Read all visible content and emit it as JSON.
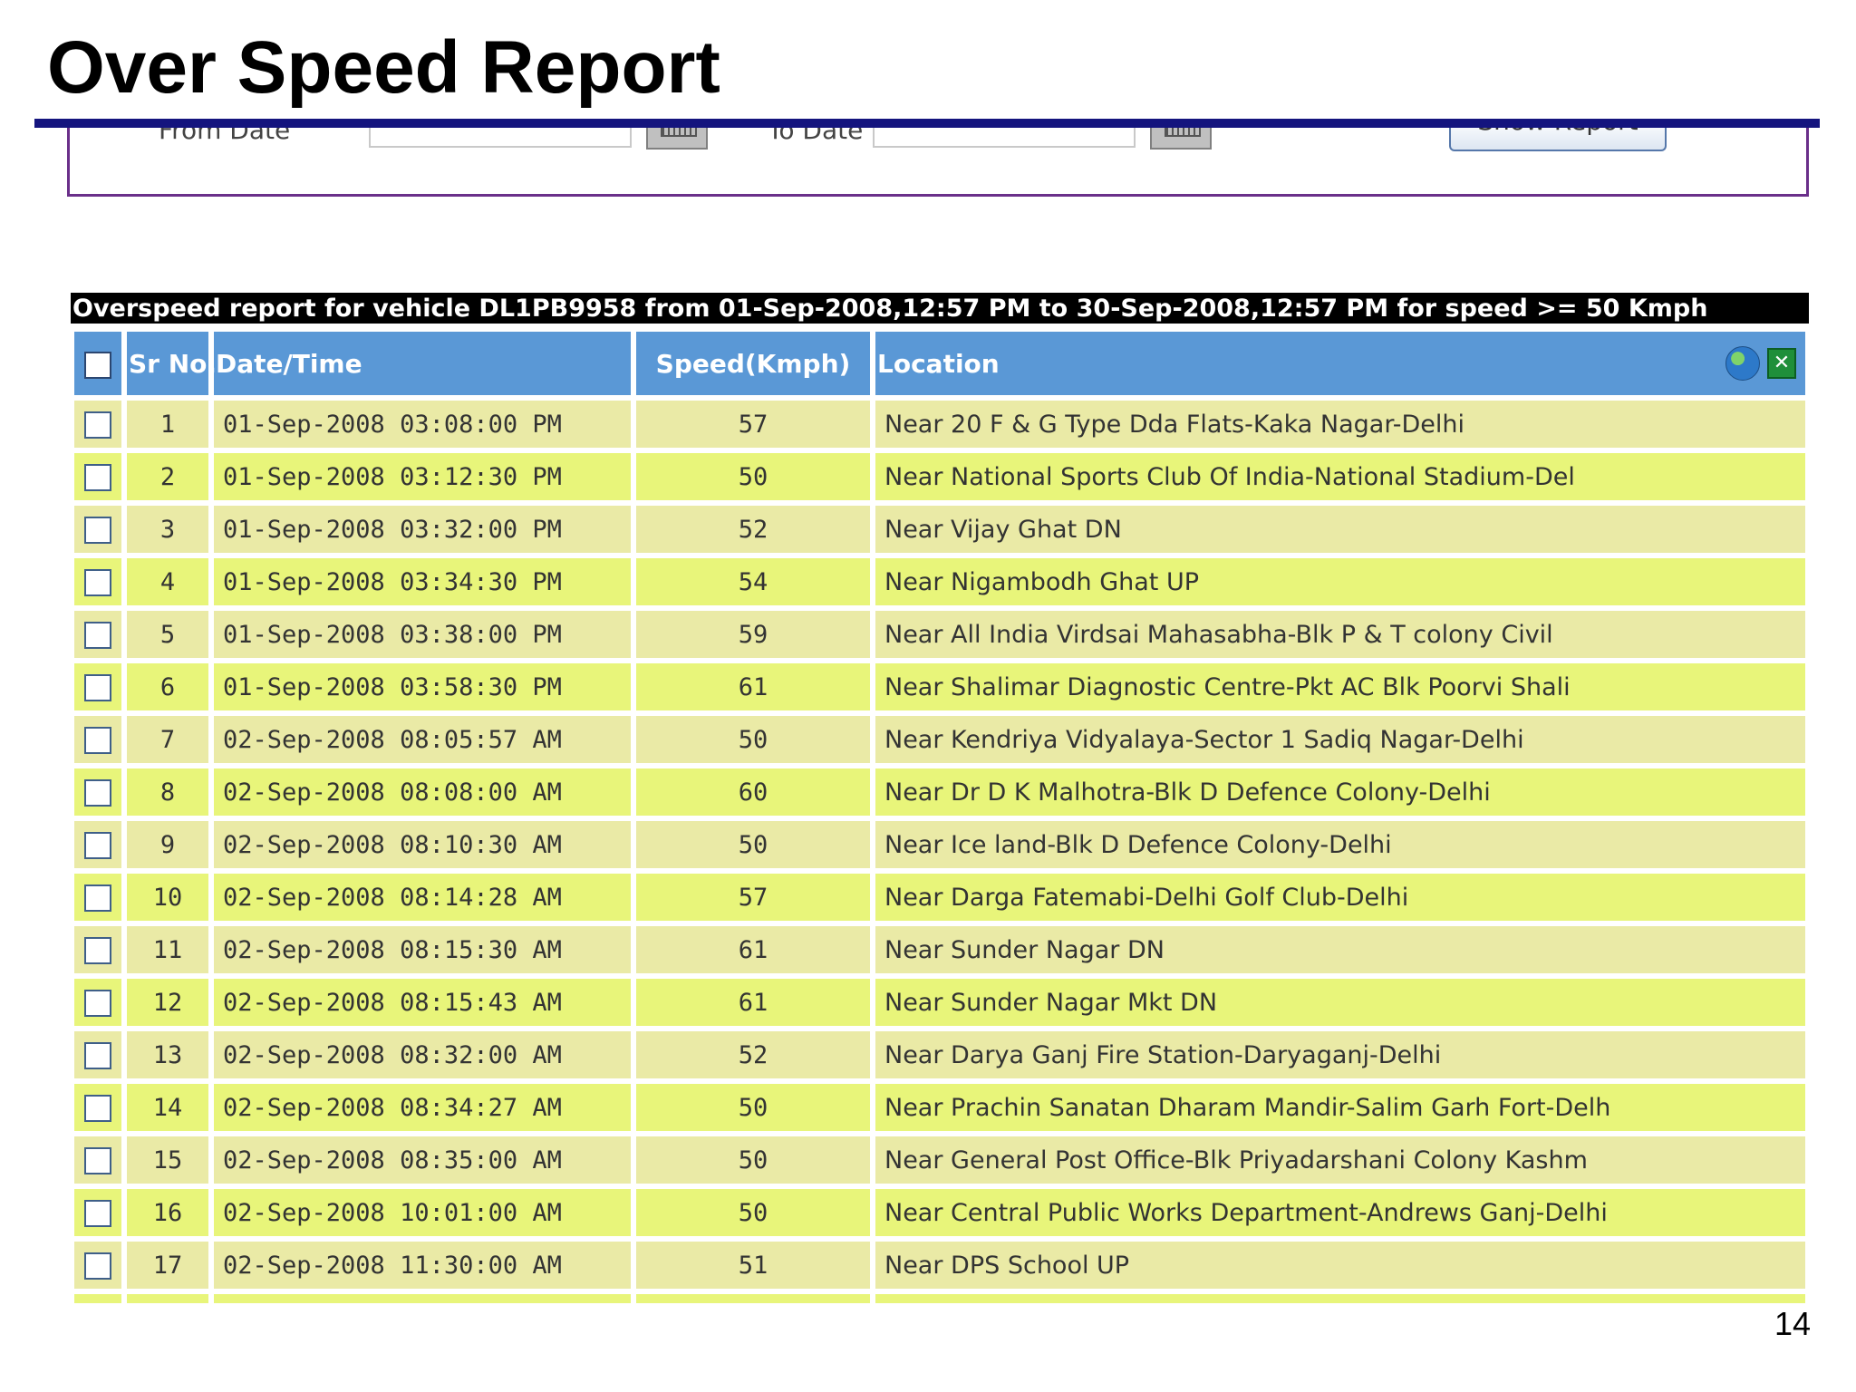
{
  "slide": {
    "title": "Over Speed Report",
    "page_number": "14"
  },
  "filter": {
    "from_label": "From Date",
    "to_label": "To Date",
    "show_button": "Show Report"
  },
  "report": {
    "caption": "Overspeed report for vehicle DL1PB9958 from 01-Sep-2008,12:57 PM to 30-Sep-2008,12:57 PM for speed >= 50 Kmph",
    "columns": [
      "Sr No.",
      "Date/Time",
      "Speed(Kmph)",
      "Location"
    ],
    "rows": [
      {
        "sr": "1",
        "datetime": "01-Sep-2008 03:08:00 PM",
        "speed": "57",
        "location": "Near 20 F & G Type Dda Flats-Kaka Nagar-Delhi"
      },
      {
        "sr": "2",
        "datetime": "01-Sep-2008 03:12:30 PM",
        "speed": "50",
        "location": "Near National Sports Club Of India-National Stadium-Del"
      },
      {
        "sr": "3",
        "datetime": "01-Sep-2008 03:32:00 PM",
        "speed": "52",
        "location": "Near Vijay Ghat DN"
      },
      {
        "sr": "4",
        "datetime": "01-Sep-2008 03:34:30 PM",
        "speed": "54",
        "location": "Near Nigambodh Ghat UP"
      },
      {
        "sr": "5",
        "datetime": "01-Sep-2008 03:38:00 PM",
        "speed": "59",
        "location": "Near All India Virdsai Mahasabha-Blk P & T colony Civil"
      },
      {
        "sr": "6",
        "datetime": "01-Sep-2008 03:58:30 PM",
        "speed": "61",
        "location": "Near Shalimar Diagnostic Centre-Pkt AC Blk Poorvi Shali"
      },
      {
        "sr": "7",
        "datetime": "02-Sep-2008 08:05:57 AM",
        "speed": "50",
        "location": "Near Kendriya Vidyalaya-Sector 1 Sadiq Nagar-Delhi"
      },
      {
        "sr": "8",
        "datetime": "02-Sep-2008 08:08:00 AM",
        "speed": "60",
        "location": "Near Dr D K Malhotra-Blk D Defence Colony-Delhi"
      },
      {
        "sr": "9",
        "datetime": "02-Sep-2008 08:10:30 AM",
        "speed": "50",
        "location": "Near Ice land-Blk D Defence Colony-Delhi"
      },
      {
        "sr": "10",
        "datetime": "02-Sep-2008 08:14:28 AM",
        "speed": "57",
        "location": "Near Darga Fatemabi-Delhi Golf Club-Delhi"
      },
      {
        "sr": "11",
        "datetime": "02-Sep-2008 08:15:30 AM",
        "speed": "61",
        "location": "Near Sunder Nagar DN"
      },
      {
        "sr": "12",
        "datetime": "02-Sep-2008 08:15:43 AM",
        "speed": "61",
        "location": "Near Sunder Nagar Mkt DN"
      },
      {
        "sr": "13",
        "datetime": "02-Sep-2008 08:32:00 AM",
        "speed": "52",
        "location": "Near Darya Ganj Fire Station-Daryaganj-Delhi"
      },
      {
        "sr": "14",
        "datetime": "02-Sep-2008 08:34:27 AM",
        "speed": "50",
        "location": "Near Prachin Sanatan Dharam Mandir-Salim Garh Fort-Delh"
      },
      {
        "sr": "15",
        "datetime": "02-Sep-2008 08:35:00 AM",
        "speed": "50",
        "location": "Near General Post Office-Blk Priyadarshani Colony Kashm"
      },
      {
        "sr": "16",
        "datetime": "02-Sep-2008 10:01:00 AM",
        "speed": "50",
        "location": "Near Central Public Works Department-Andrews Ganj-Delhi"
      },
      {
        "sr": "17",
        "datetime": "02-Sep-2008 11:30:00 AM",
        "speed": "51",
        "location": "Near DPS School UP"
      }
    ]
  },
  "icons": {
    "map": "globe-icon",
    "export": "excel-icon"
  }
}
